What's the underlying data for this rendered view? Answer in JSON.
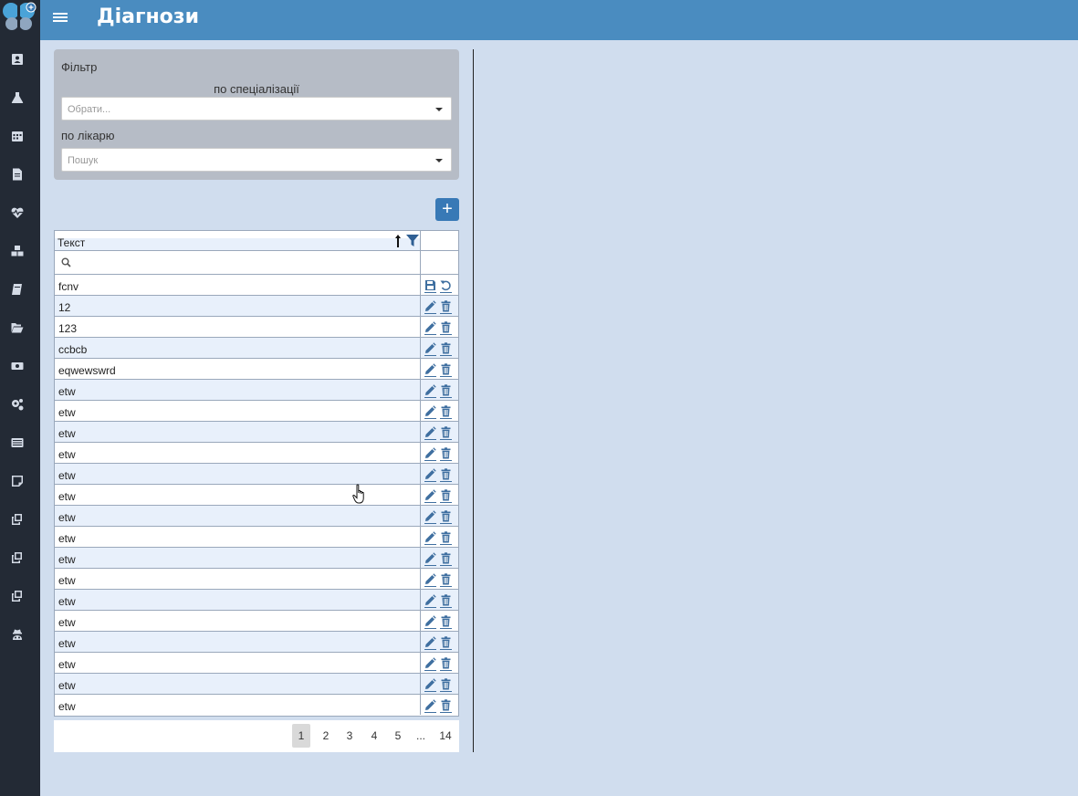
{
  "header": {
    "title": "Діагнози"
  },
  "sidebar": {
    "icons": [
      "patient-card-icon",
      "flask-icon",
      "calendar-icon",
      "document-icon",
      "heartbeat-icon",
      "cubes-icon",
      "book-icon",
      "folder-open-icon",
      "money-icon",
      "cogs-icon",
      "list-icon",
      "sticky-note-icon",
      "copy-icon",
      "copy-icon",
      "copy-icon",
      "user-secret-icon"
    ]
  },
  "filter": {
    "title": "Фільтр",
    "specialization_label": "по спеціалізації",
    "specialization_placeholder": "Обрати...",
    "doctor_label": "по лікарю",
    "doctor_placeholder": "Пошук"
  },
  "grid": {
    "column_header": "Текст",
    "rows": [
      {
        "text": "fcnv",
        "editing": true
      },
      {
        "text": "12"
      },
      {
        "text": "123"
      },
      {
        "text": "ccbcb"
      },
      {
        "text": "eqwewswrd"
      },
      {
        "text": "etw"
      },
      {
        "text": "etw"
      },
      {
        "text": "etw"
      },
      {
        "text": "etw"
      },
      {
        "text": "etw"
      },
      {
        "text": "etw"
      },
      {
        "text": "etw"
      },
      {
        "text": "etw"
      },
      {
        "text": "etw"
      },
      {
        "text": "etw"
      },
      {
        "text": "etw"
      },
      {
        "text": "etw"
      },
      {
        "text": "etw"
      },
      {
        "text": "etw"
      },
      {
        "text": "etw"
      },
      {
        "text": "etw"
      }
    ]
  },
  "pager": {
    "pages": [
      "1",
      "2",
      "3",
      "4",
      "5",
      "...",
      "14"
    ],
    "current": "1"
  },
  "colors": {
    "header": "#4a8cc0",
    "sidebar": "#232a35",
    "accent": "#3879b6",
    "background": "#d0ddee"
  }
}
